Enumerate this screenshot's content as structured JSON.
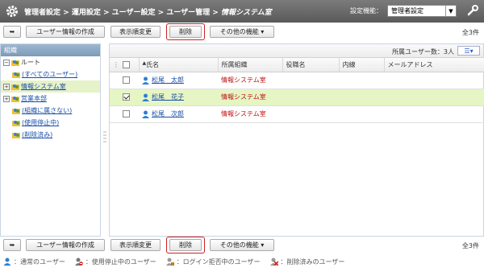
{
  "header": {
    "crumbs": [
      "管理者設定",
      "運用設定",
      "ユーザー設定",
      "ユーザー管理"
    ],
    "separator": " > ",
    "current": "情報システム室",
    "setting_label": "設定機能：",
    "setting_value": "管理者設定"
  },
  "toolbar": {
    "back_icon": "back-arrow-icon",
    "create_label": "ユーザー情報の作成",
    "order_label": "表示順変更",
    "delete_label": "削除",
    "other_label": "その他の機能",
    "count": "全3件"
  },
  "left": {
    "title": "組織",
    "nodes": [
      {
        "label": "ルート",
        "expander": "⊟",
        "link": false
      },
      {
        "label": "(すべてのユーザー)",
        "expander": "",
        "link": true
      },
      {
        "label": "情報システム室",
        "expander": "⊞",
        "link": true,
        "selected": true
      },
      {
        "label": "営業本部",
        "expander": "⊞",
        "link": true
      },
      {
        "label": "(組織に属さない)",
        "expander": "",
        "link": true
      },
      {
        "label": "(使用停止中)",
        "expander": "",
        "link": true
      },
      {
        "label": "(削除済み)",
        "expander": "",
        "link": true
      }
    ]
  },
  "right": {
    "member_count": "所属ユーザー数：3人",
    "columns": [
      "",
      "氏名",
      "所属組織",
      "役職名",
      "内線",
      "メールアドレス"
    ],
    "rows": [
      {
        "name": "松尾　太郎",
        "org": "情報システム室",
        "title": "",
        "ext": "",
        "mail": "",
        "checked": false
      },
      {
        "name": "松尾　花子",
        "org": "情報システム室",
        "title": "",
        "ext": "",
        "mail": "",
        "checked": true
      },
      {
        "name": "松尾　次郎",
        "org": "情報システム室",
        "title": "",
        "ext": "",
        "mail": "",
        "checked": false
      }
    ]
  },
  "legend": [
    {
      "icon": "user-icon",
      "label": "：通常のユーザー"
    },
    {
      "icon": "user-suspended-icon",
      "label": "：使用停止中のユーザー"
    },
    {
      "icon": "user-login-denied-icon",
      "label": "：ログイン拒否中のユーザー"
    },
    {
      "icon": "user-deleted-icon",
      "label": "：削除済みのユーザー"
    }
  ],
  "colors": {
    "accent": "#7c9ab8",
    "selected": "#e6f5c4",
    "org_text": "#c01010",
    "highlight": "#d02020"
  }
}
